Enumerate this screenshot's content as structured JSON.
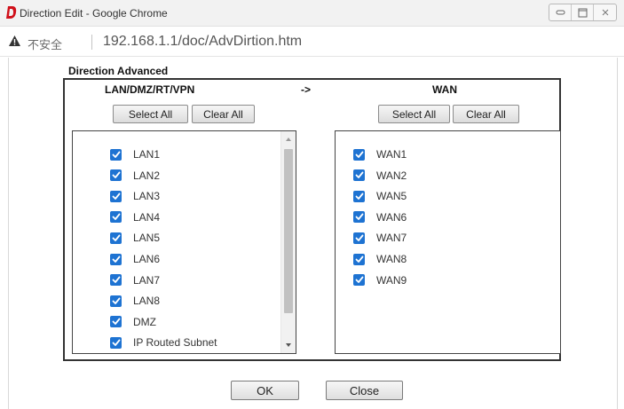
{
  "window": {
    "title": "Direction Edit - Google Chrome",
    "logo": "draytek-d-logo",
    "controls": [
      "minimize-icon",
      "maximize-icon",
      "close-icon"
    ]
  },
  "address_bar": {
    "security_icon": "warning-triangle-icon",
    "security_label": "不安全",
    "url": "192.168.1.1/doc/AdvDirtion.htm"
  },
  "panel": {
    "title": "Direction Advanced",
    "arrow": "->",
    "source": {
      "header": "LAN/DMZ/RT/VPN",
      "select_all_label": "Select All",
      "clear_all_label": "Clear All",
      "items": [
        {
          "label": "LAN1",
          "checked": true
        },
        {
          "label": "LAN2",
          "checked": true
        },
        {
          "label": "LAN3",
          "checked": true
        },
        {
          "label": "LAN4",
          "checked": true
        },
        {
          "label": "LAN5",
          "checked": true
        },
        {
          "label": "LAN6",
          "checked": true
        },
        {
          "label": "LAN7",
          "checked": true
        },
        {
          "label": "LAN8",
          "checked": true
        },
        {
          "label": "DMZ",
          "checked": true
        },
        {
          "label": "IP Routed Subnet",
          "checked": true
        }
      ]
    },
    "destination": {
      "header": "WAN",
      "select_all_label": "Select All",
      "clear_all_label": "Clear All",
      "items": [
        {
          "label": "WAN1",
          "checked": true
        },
        {
          "label": "WAN2",
          "checked": true
        },
        {
          "label": "WAN5",
          "checked": true
        },
        {
          "label": "WAN6",
          "checked": true
        },
        {
          "label": "WAN7",
          "checked": true
        },
        {
          "label": "WAN8",
          "checked": true
        },
        {
          "label": "WAN9",
          "checked": true
        }
      ]
    }
  },
  "footer": {
    "ok_label": "OK",
    "close_label": "Close"
  },
  "colors": {
    "checkbox": "#1e73d2",
    "border": "#333333"
  }
}
